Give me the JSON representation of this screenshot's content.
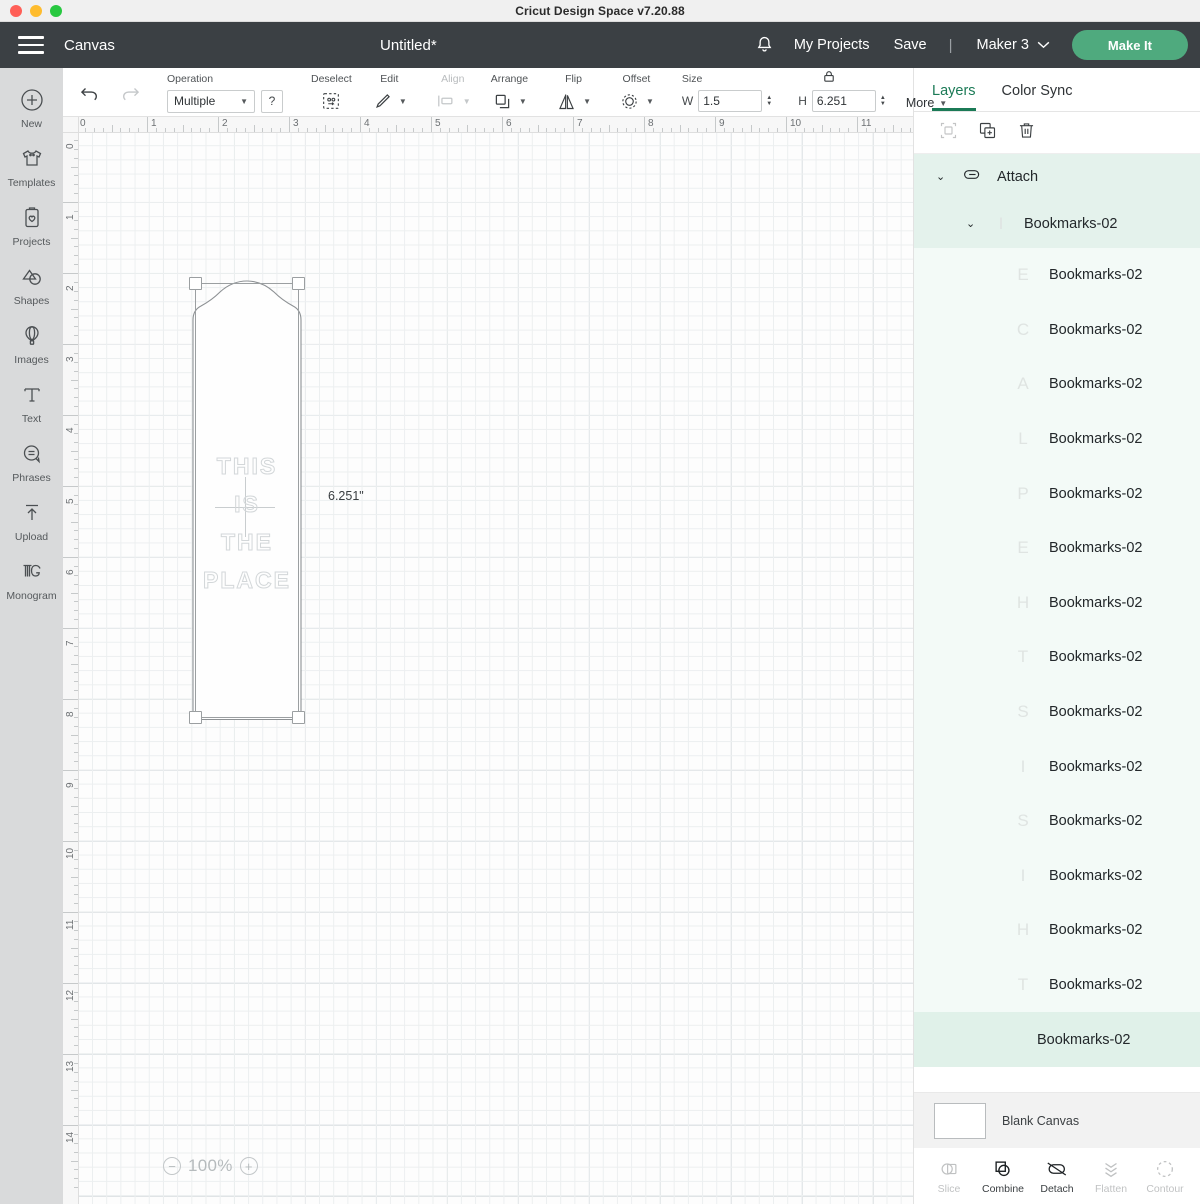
{
  "window": {
    "app_title": "Cricut Design Space  v7.20.88",
    "traffic_lights": [
      "close",
      "minimize",
      "zoom"
    ]
  },
  "navbar": {
    "menu_icon": "hamburger-icon",
    "canvas_label": "Canvas",
    "document_title": "Untitled*",
    "bell_icon": "notification-bell-icon",
    "my_projects_label": "My Projects",
    "save_label": "Save",
    "separator": "|",
    "machine_label": "Maker 3",
    "machine_caret": "chevron-down-icon",
    "make_it_label": "Make It",
    "make_it_color": "#4faa7e",
    "bar_color": "#3b4044"
  },
  "sidebar": {
    "items": [
      {
        "label": "New",
        "icon": "plus-circle-icon"
      },
      {
        "label": "Templates",
        "icon": "tshirt-icon"
      },
      {
        "label": "Projects",
        "icon": "clipboard-heart-icon"
      },
      {
        "label": "Shapes",
        "icon": "shapes-icon"
      },
      {
        "label": "Images",
        "icon": "hot-air-balloon-icon"
      },
      {
        "label": "Text",
        "icon": "text-t-icon"
      },
      {
        "label": "Phrases",
        "icon": "speech-bubble-icon"
      },
      {
        "label": "Upload",
        "icon": "upload-arrow-icon"
      },
      {
        "label": "Monogram",
        "icon": "monogram-mg-icon"
      }
    ]
  },
  "toolbar": {
    "undo_icon": "undo-arrow-icon",
    "redo_icon": "redo-arrow-icon",
    "operation_label": "Operation",
    "operation_value": "Multiple",
    "operation_options": [
      "Multiple"
    ],
    "help_label": "?",
    "deselect_label": "Deselect",
    "edit_label": "Edit",
    "align_label": "Align",
    "arrange_label": "Arrange",
    "flip_label": "Flip",
    "offset_label": "Offset",
    "size_label": "Size",
    "width_label": "W",
    "width_value": "1.5",
    "height_label": "H",
    "height_value": "6.251",
    "lock_icon": "lock-closed-icon",
    "more_label": "More"
  },
  "canvas": {
    "ruler_h_numbers": [
      "0",
      "1",
      "2",
      "3",
      "4",
      "5",
      "6",
      "7",
      "8",
      "9",
      "10",
      "11"
    ],
    "ruler_v_numbers": [
      "0",
      "1",
      "2",
      "3",
      "4",
      "5",
      "6",
      "7",
      "8",
      "9",
      "10",
      "11",
      "12",
      "13",
      "14"
    ],
    "dimension_label": "6.251\"",
    "zoom_out_icon": "minus-circle-icon",
    "zoom_value": "100%",
    "zoom_in_icon": "plus-circle-icon",
    "design_text_lines": [
      "THIS",
      "IS",
      "THE",
      "PLACE"
    ]
  },
  "panel": {
    "tabs": [
      {
        "label": "Layers",
        "active": true
      },
      {
        "label": "Color Sync",
        "active": false
      }
    ],
    "tools": [
      {
        "name": "group-icon",
        "disabled": true
      },
      {
        "name": "duplicate-icon",
        "disabled": false
      },
      {
        "name": "delete-trash-icon",
        "disabled": false
      }
    ],
    "attach_group": {
      "label": "Attach",
      "icon": "paperclip-icon",
      "chevron": "chevron-down-icon"
    },
    "group_row": {
      "label": "Bookmarks-02",
      "chevron": "chevron-down-icon",
      "thumb": "I"
    },
    "layers": [
      {
        "label": "Bookmarks-02",
        "thumb": "E",
        "selected": false
      },
      {
        "label": "Bookmarks-02",
        "thumb": "C",
        "selected": false
      },
      {
        "label": "Bookmarks-02",
        "thumb": "A",
        "selected": false
      },
      {
        "label": "Bookmarks-02",
        "thumb": "L",
        "selected": false
      },
      {
        "label": "Bookmarks-02",
        "thumb": "P",
        "selected": false
      },
      {
        "label": "Bookmarks-02",
        "thumb": "E",
        "selected": false
      },
      {
        "label": "Bookmarks-02",
        "thumb": "H",
        "selected": false
      },
      {
        "label": "Bookmarks-02",
        "thumb": "T",
        "selected": false
      },
      {
        "label": "Bookmarks-02",
        "thumb": "S",
        "selected": false
      },
      {
        "label": "Bookmarks-02",
        "thumb": "I",
        "selected": false
      },
      {
        "label": "Bookmarks-02",
        "thumb": "S",
        "selected": false
      },
      {
        "label": "Bookmarks-02",
        "thumb": "I",
        "selected": false
      },
      {
        "label": "Bookmarks-02",
        "thumb": "H",
        "selected": false
      },
      {
        "label": "Bookmarks-02",
        "thumb": "T",
        "selected": false
      },
      {
        "label": "Bookmarks-02",
        "thumb": "",
        "selected": true
      }
    ],
    "canvas_row": {
      "label": "Blank Canvas",
      "swatch_color": "#ffffff"
    },
    "actions": [
      {
        "label": "Slice",
        "icon": "slice-icon",
        "disabled": true
      },
      {
        "label": "Combine",
        "icon": "combine-icon",
        "disabled": false
      },
      {
        "label": "Detach",
        "icon": "detach-icon",
        "disabled": false
      },
      {
        "label": "Flatten",
        "icon": "flatten-icon",
        "disabled": true
      },
      {
        "label": "Contour",
        "icon": "contour-icon",
        "disabled": true
      }
    ],
    "accent_color": "#1b7a56",
    "highlight_color": "#e4f2ec"
  }
}
